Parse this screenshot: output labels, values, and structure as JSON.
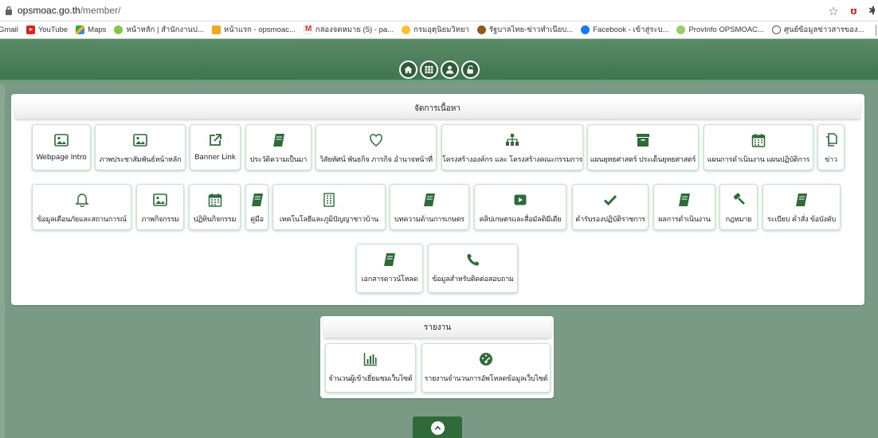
{
  "browser": {
    "url_host": "opsmoac.go.th",
    "url_path": "/member/",
    "bookmarks": [
      {
        "label": "Gmail",
        "icon": "gmail-partial"
      },
      {
        "label": "YouTube",
        "icon": "youtube-icon"
      },
      {
        "label": "Maps",
        "icon": "maps-icon"
      },
      {
        "label": "หน้าหลัก | สำนักงานป...",
        "icon": "site-icon"
      },
      {
        "label": "หน้าแรก - opsmoac...",
        "icon": "site-icon"
      },
      {
        "label": "กล่องจดหมาย (5) - pa...",
        "icon": "gmail-icon"
      },
      {
        "label": "กรมอุตุนิยมวิทยา",
        "icon": "weather-icon"
      },
      {
        "label": "รัฐบาลไทย-ข่าวทำเนียบ...",
        "icon": "gov-icon"
      },
      {
        "label": "Facebook - เข้าสู่ระบ...",
        "icon": "facebook-icon"
      },
      {
        "label": "ProvInfo OPSMOAC...",
        "icon": "site-icon"
      },
      {
        "label": "ศูนย์ข้อมูลข่าวสารของ...",
        "icon": "globe-icon"
      }
    ]
  },
  "content_panel": {
    "title": "จัดการเนื้อหา",
    "tiles": [
      {
        "label": "Webpage Intro",
        "icon": "image-icon"
      },
      {
        "label": "ภาพประชาสัมพันธ์หน้าหลัก",
        "icon": "image-icon"
      },
      {
        "label": "Banner Link",
        "icon": "external-link-icon"
      },
      {
        "label": "ประวัติความเป็นมา",
        "icon": "book-icon"
      },
      {
        "label": "วิสัยทัศน์ พันธกิจ ภารกิจ อำนาจหน้าที่",
        "icon": "heart-icon"
      },
      {
        "label": "โครงสร้างองค์กร และ โครงสร้างคณะกรรมการ",
        "icon": "org-chart-icon"
      },
      {
        "label": "แผนยุทธศาสตร์ ประเด็นยุทธศาสตร์",
        "icon": "archive-icon"
      },
      {
        "label": "แผนการดำเนินงาน แผนปฏิบัติการ",
        "icon": "calendar-icon"
      },
      {
        "label": "ข่าว",
        "icon": "copy-icon"
      },
      {
        "label": "ข้อมูลเตือนภัยและสถานการณ์",
        "icon": "bell-icon"
      },
      {
        "label": "ภาพกิจกรรม",
        "icon": "image-icon"
      },
      {
        "label": "ปฏิทินกิจกรรม",
        "icon": "calendar-icon"
      },
      {
        "label": "คู่มือ",
        "icon": "book-icon"
      },
      {
        "label": "เทคโนโลยีและภูมิปัญญาชาวบ้าน",
        "icon": "building-icon"
      },
      {
        "label": "บทความด้านการเกษตร",
        "icon": "book-icon"
      },
      {
        "label": "คลิปเกษตรและสื่อมัลติมีเดีย",
        "icon": "video-icon"
      },
      {
        "label": "คำรับรองปฏิบัติราชการ",
        "icon": "check-icon"
      },
      {
        "label": "ผลการดำเนินงาน",
        "icon": "book-icon"
      },
      {
        "label": "กฎหมาย",
        "icon": "gavel-icon"
      },
      {
        "label": "ระเบียบ คำสั่ง ข้อบังคับ",
        "icon": "book-icon"
      },
      {
        "label": "เอกสารดาวน์โหลด",
        "icon": "book-icon"
      },
      {
        "label": "ข้อมูลสำหรับติดต่อสอบถาม",
        "icon": "phone-icon"
      }
    ]
  },
  "report_panel": {
    "title": "รายงาน",
    "tiles": [
      {
        "label": "จำนวนผู้เข้าเยี่ยมชมเว็บไซต์",
        "icon": "bar-chart-icon"
      },
      {
        "label": "รายงานจำนวนการอัพโหลดข้อมูลเว็บไซต์",
        "icon": "dashboard-icon"
      }
    ]
  },
  "colors": {
    "header_green": "#3f7450",
    "icon_green": "#2e6b39",
    "page_bg": "#7a9a86"
  }
}
